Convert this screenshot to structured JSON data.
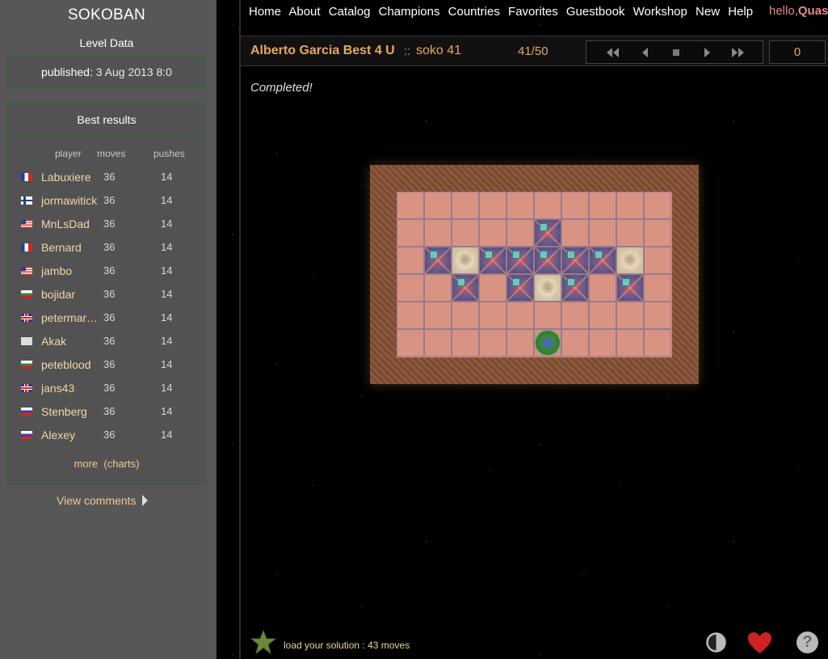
{
  "sidebar": {
    "app_title": "SOKOBAN",
    "level_data_heading": "Level Data",
    "published_label": "published:",
    "published_value": "3 Aug 2013 8:0",
    "best_results_heading": "Best results",
    "columns": {
      "player": "player",
      "moves": "moves",
      "pushes": "pushes"
    },
    "results": [
      {
        "flag": "fr",
        "player": "Labuxiere",
        "moves": "36",
        "pushes": "14"
      },
      {
        "flag": "fi",
        "player": "jormawitick",
        "moves": "36",
        "pushes": "14"
      },
      {
        "flag": "us",
        "player": "MnLsDad",
        "moves": "36",
        "pushes": "14"
      },
      {
        "flag": "fr",
        "player": "Bernard",
        "moves": "36",
        "pushes": "14"
      },
      {
        "flag": "us",
        "player": "jambo",
        "moves": "36",
        "pushes": "14"
      },
      {
        "flag": "bg",
        "player": "bojidar",
        "moves": "36",
        "pushes": "14"
      },
      {
        "flag": "gb",
        "player": "petermar…",
        "moves": "36",
        "pushes": "14"
      },
      {
        "flag": "none",
        "player": "Akak",
        "moves": "36",
        "pushes": "14"
      },
      {
        "flag": "bg",
        "player": "peteblood",
        "moves": "36",
        "pushes": "14"
      },
      {
        "flag": "gb",
        "player": "jans43",
        "moves": "36",
        "pushes": "14"
      },
      {
        "flag": "ru",
        "player": "Stenberg",
        "moves": "36",
        "pushes": "14"
      },
      {
        "flag": "ru",
        "player": "Alexey",
        "moves": "36",
        "pushes": "14"
      }
    ],
    "more_label": "more",
    "charts_label": "(charts)",
    "view_comments_label": "View comments"
  },
  "nav": {
    "items": [
      "Home",
      "About",
      "Catalog",
      "Champions",
      "Countries",
      "Favorites",
      "Guestbook",
      "Workshop",
      "New",
      "Help"
    ],
    "hello_text": "hello,",
    "username": "Quas"
  },
  "level": {
    "collection": "Alberto Garcia Best 4 U",
    "separator": "::",
    "name": "soko 41",
    "counter": "41/50",
    "move_count": "0",
    "status": "Completed!"
  },
  "board": {
    "cols": 10,
    "rows": 6,
    "legend": {
      "B": "box",
      "G": "goal",
      "P": "pusher",
      ".": "floor"
    },
    "layout": [
      "..........",
      ".....B....",
      ".BGBBBBBG.",
      "..B.BGB.B.",
      "..........",
      ".....P...."
    ]
  },
  "footer": {
    "load_solution": "load your solution : 43 moves"
  },
  "colors": {
    "sidebar_bg": "#575757",
    "accent_orange": "#e8a663",
    "player_name": "#f0d6a8",
    "floor": "#d99383",
    "heart": "#cc2222"
  }
}
